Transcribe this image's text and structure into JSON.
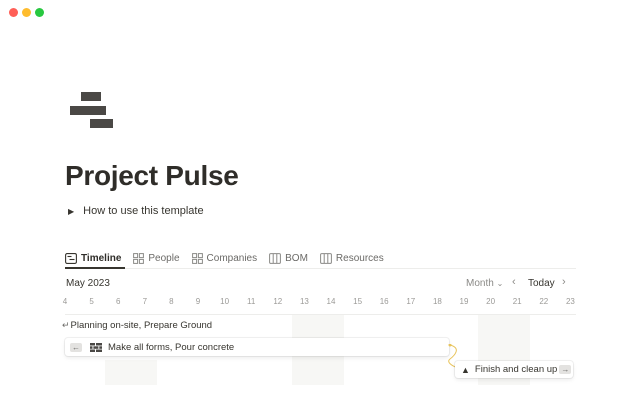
{
  "window_controls": {
    "close_color": "#ff5f57",
    "minimize_color": "#febc2e",
    "zoom_color": "#28c840"
  },
  "page": {
    "icon": "bricks-icon",
    "title": "Project Pulse",
    "toggle_label": "How to use this template"
  },
  "tabs": [
    {
      "label": "Timeline",
      "icon": "timeline-icon",
      "active": true
    },
    {
      "label": "People",
      "icon": "gallery-icon",
      "active": false
    },
    {
      "label": "Companies",
      "icon": "gallery-icon",
      "active": false
    },
    {
      "label": "BOM",
      "icon": "table-icon",
      "active": false
    },
    {
      "label": "Resources",
      "icon": "table-icon",
      "active": false
    }
  ],
  "timeline": {
    "month_label": "May 2023",
    "scale_label": "Month",
    "today_label": "Today",
    "days": [
      "4",
      "5",
      "6",
      "7",
      "8",
      "9",
      "10",
      "11",
      "12",
      "13",
      "14",
      "15",
      "16",
      "17",
      "18",
      "19",
      "20",
      "21",
      "22",
      "23"
    ],
    "items": [
      {
        "label": "Planning on-site, Prepare Ground",
        "icon": "back-arrow-icon"
      },
      {
        "label": "Make all forms, Pour concrete",
        "icon": "brick-wall-icon"
      },
      {
        "label": "Finish and clean up",
        "icon": "broom-icon"
      }
    ]
  }
}
